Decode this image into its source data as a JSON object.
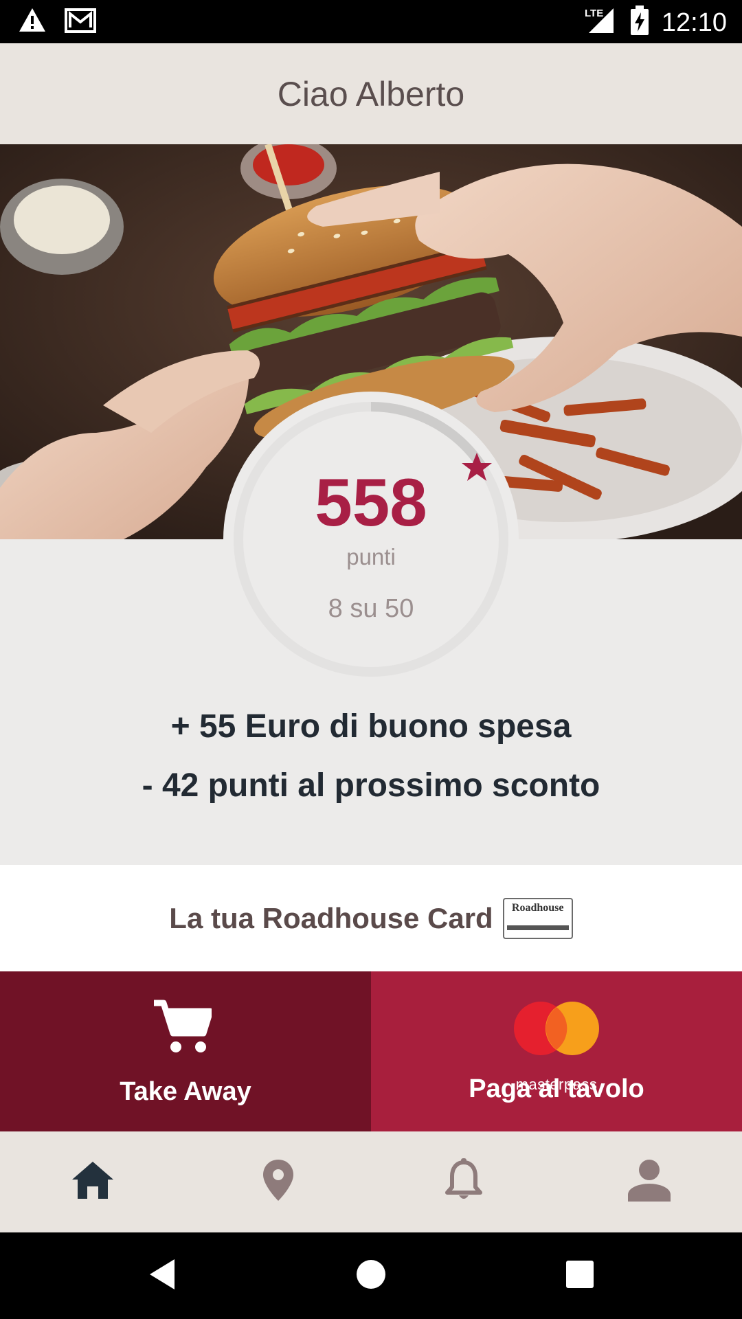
{
  "status_bar": {
    "time": "12:10",
    "network": "LTE",
    "icons": [
      "warning-icon",
      "gmail-icon",
      "signal-icon",
      "battery-charging-icon"
    ]
  },
  "header": {
    "title": "Ciao Alberto"
  },
  "points": {
    "value": "558",
    "unit_label": "punti",
    "progress_text": "8 su 50",
    "progress_fraction": 0.16,
    "accent_color": "#a81f45"
  },
  "info": {
    "line1": "+ 55 Euro di buono spesa",
    "line2": "- 42 punti al prossimo sconto"
  },
  "card": {
    "label": "La tua Roadhouse Card",
    "logo_text": "Roadhouse"
  },
  "actions": {
    "takeaway": {
      "label": "Take Away",
      "icon": "cart-icon",
      "color": "#701226"
    },
    "pay": {
      "label": "Paga al tavolo",
      "logo_text": "masterpass",
      "color": "#a81f3d"
    }
  },
  "bottom_nav": {
    "items": [
      {
        "icon": "home-icon",
        "active": true
      },
      {
        "icon": "location-pin-icon",
        "active": false
      },
      {
        "icon": "bell-icon",
        "active": false
      },
      {
        "icon": "profile-icon",
        "active": false
      }
    ]
  },
  "system_nav": {
    "icons": [
      "back-icon",
      "home-circle-icon",
      "recents-icon"
    ]
  }
}
